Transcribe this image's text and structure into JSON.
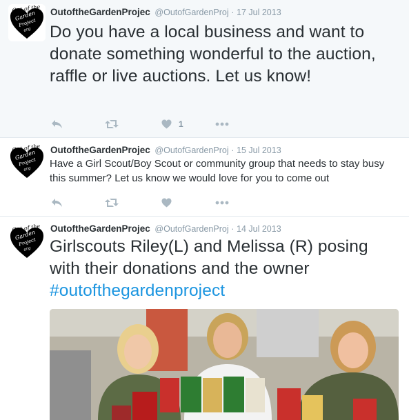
{
  "tweets": [
    {
      "fullname": "OutoftheGardenProjec",
      "handle": "@OutofGardenProj",
      "separator": "·",
      "date": "17 Jul 2013",
      "text": "Do you have a local business and want to donate something wonderful to the auction, raffle or live auctions. Let us know!",
      "like_count": "1",
      "icons": [
        "reply-icon",
        "retweet-icon",
        "heart-icon",
        "more-icon"
      ]
    },
    {
      "fullname": "OutoftheGardenProjec",
      "handle": "@OutofGardenProj",
      "separator": "·",
      "date": "15 Jul 2013",
      "text": "Have a Girl Scout/Boy Scout or community group that needs to stay busy this summer? Let us know we would love for you to come out",
      "icons": [
        "reply-icon",
        "retweet-icon",
        "heart-icon",
        "more-icon"
      ]
    },
    {
      "fullname": "OutoftheGardenProjec",
      "handle": "@OutofGardenProj",
      "separator": "·",
      "date": "14 Jul 2013",
      "text": "Girlscouts Riley(L) and Melissa (R) posing with their donations and the owner",
      "hashtag": "#outofthegardenproject"
    }
  ],
  "avatar_logo_text": "Out of the Garden Project org",
  "colors": {
    "name": "#292f33",
    "meta": "#8899a6",
    "action_icon": "#aab8c2",
    "hashtag": "#1b95e0",
    "highlight_bg": "#f5f8fa",
    "divider": "#e1e8ed"
  }
}
